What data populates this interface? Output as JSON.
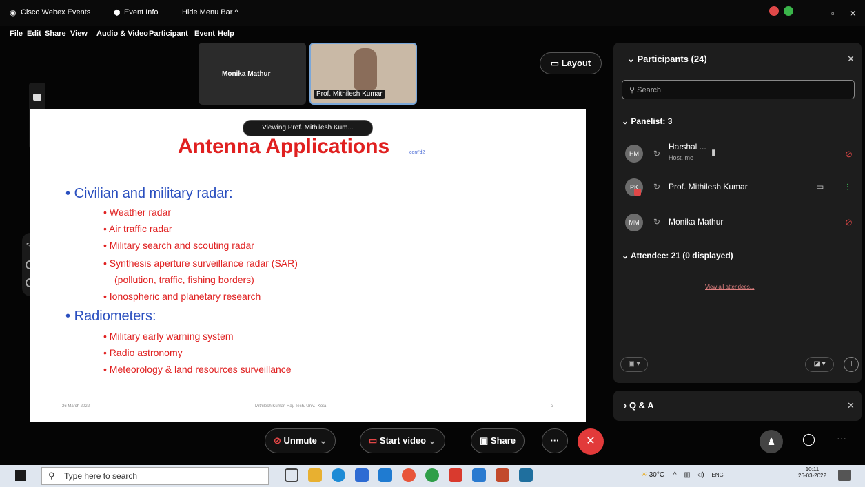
{
  "titlebar": {
    "app_name": "Cisco Webex Events",
    "event_info": "Event Info",
    "hide_menu": "Hide Menu Bar ^",
    "minimize": "–",
    "restore": "▫",
    "close": "✕"
  },
  "menu": [
    "File",
    "Edit",
    "Share",
    "View",
    "Audio & Video",
    "Participant",
    "Event",
    "Help"
  ],
  "thumbnails": {
    "monika": "Monika Mathur",
    "mithilesh": "Prof. Mithilesh Kumar"
  },
  "layout_button": "Layout",
  "viewing_pill": "Viewing Prof. Mithilesh Kum...",
  "slide": {
    "title": "Antenna Applications",
    "subtitle": "cont'd2",
    "bullets": [
      "Civilian and military radar:",
      "Radiometers:"
    ],
    "radar_items": [
      "Weather radar",
      "Air traffic radar",
      "Military search and scouting radar",
      "Synthesis aperture surveillance radar (SAR)",
      "(pollution, traffic, fishing borders)",
      "Ionospheric and planetary research"
    ],
    "radiometer_items": [
      "Military early warning system",
      "Radio astronomy",
      "Meteorology & land resources surveillance"
    ],
    "footer_left": "26 March 2022",
    "footer_center": "Mithilesh Kumar, Raj. Tech. Univ., Kota",
    "footer_right": "3"
  },
  "participants": {
    "title": "Participants (24)",
    "search_placeholder": "Search",
    "panelist_header": "Panelist: 3",
    "panelists": [
      {
        "initials": "HM",
        "name": "Harshal ...",
        "role": "Host, me"
      },
      {
        "initials": "PK",
        "name": "Prof. Mithilesh Kumar"
      },
      {
        "initials": "MM",
        "name": "Monika Mathur"
      }
    ],
    "attendee_header": "Attendee: 21 (0 displayed)",
    "view_all": "View all attendees..."
  },
  "qa": {
    "title": "Q & A"
  },
  "controls": {
    "unmute": "Unmute",
    "start_video": "Start video",
    "share": "Share",
    "more": "···",
    "end": "✕"
  },
  "taskbar": {
    "search_placeholder": "Type here to search",
    "weather": "30°C",
    "lang": "ENG",
    "time": "10:11",
    "date": "26-03-2022"
  },
  "colors": {
    "slide_title": "#e02020",
    "slide_bullet": "#2a4fbf",
    "end_call": "#e23a3a",
    "panel": "#1d1d1d"
  }
}
